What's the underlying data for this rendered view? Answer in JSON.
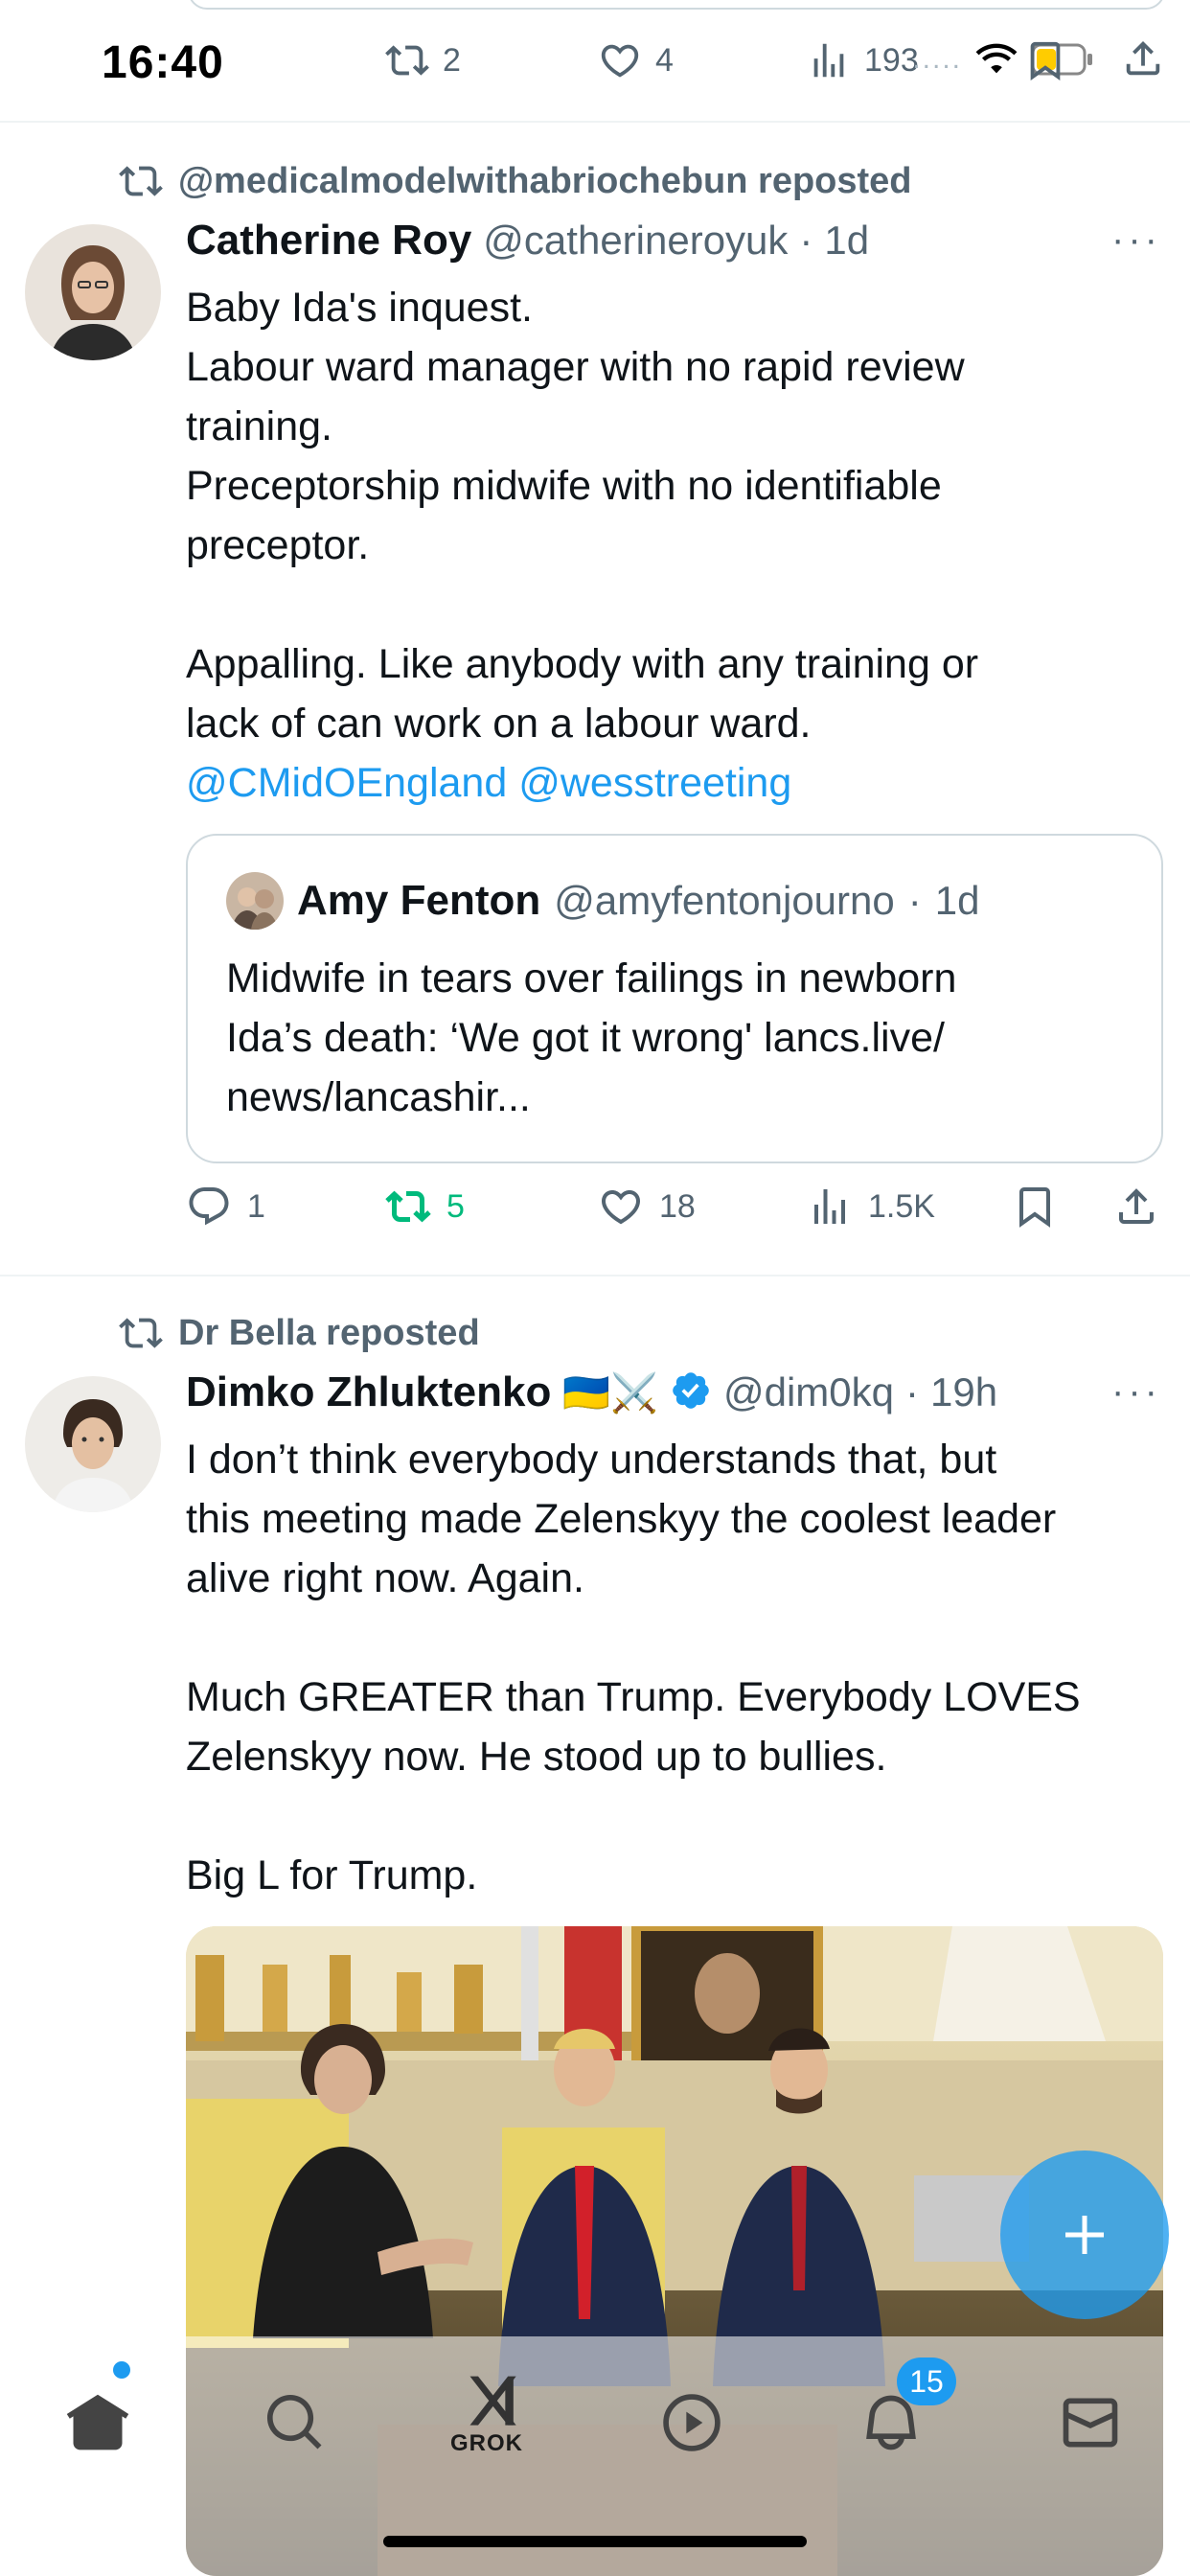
{
  "status_bar": {
    "time": "16:40",
    "dots": "....."
  },
  "previous_tweet_actions": {
    "reposts": "2",
    "likes": "4",
    "views": "193"
  },
  "tweets": [
    {
      "repost_label": "@medicalmodelwithabriochebun reposted",
      "name": "Catherine Roy",
      "handle": "@catherineroyuk",
      "sep": "·",
      "age": "1d",
      "more": "···",
      "lines": [
        "Baby Ida's inquest.",
        "Labour ward manager with no rapid review",
        "training.",
        "Preceptorship midwife with no identifiable",
        "preceptor.",
        "Appalling. Like anybody with any training or",
        "lack of can work on a labour ward."
      ],
      "mentions": [
        "@CMidOEngland",
        "@wesstreeting"
      ],
      "quote": {
        "name": "Amy Fenton",
        "handle": "@amyfentonjourno",
        "sep": "·",
        "age": "1d",
        "lines": [
          "Midwife in tears over failings in newborn",
          "Ida’s death: ‘We got it wrong' lancs.live/",
          "news/lancashir..."
        ]
      },
      "actions": {
        "replies": "1",
        "reposts": "5",
        "likes": "18",
        "views": "1.5K"
      }
    },
    {
      "repost_label": "Dr Bella reposted",
      "name": "Dimko Zhluktenko",
      "name_emoji": "🇺🇦⚔️",
      "handle": "@dim0kq",
      "sep": "·",
      "age": "19h",
      "more": "···",
      "lines": [
        "I don’t think everybody understands that, but",
        "this meeting made Zelenskyy the coolest leader",
        "alive right now. Again.",
        "Much GREATER than Trump. Everybody LOVES",
        "Zelenskyy now. He stood up to bullies.",
        "Big L for Trump."
      ]
    }
  ],
  "tab_bar": {
    "grok_label": "GROK",
    "notification_count": "15"
  },
  "colors": {
    "accent": "#1d9bf0",
    "repost_green": "#00ba7c",
    "secondary_text": "#536471",
    "divider": "#eff3f4"
  },
  "icons": [
    "repost-icon",
    "heart-icon",
    "views-icon",
    "bookmark-icon",
    "share-icon",
    "reply-icon",
    "verified-icon",
    "home-icon",
    "search-icon",
    "grok-icon",
    "video-icon",
    "bell-icon",
    "mail-icon",
    "plus-icon"
  ]
}
